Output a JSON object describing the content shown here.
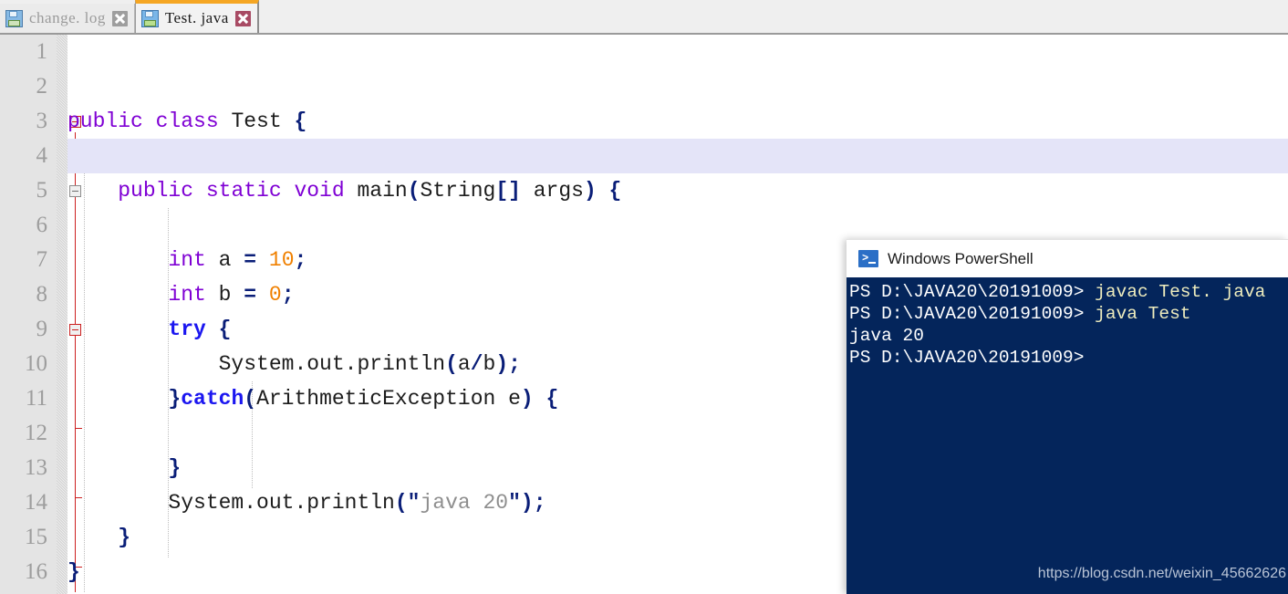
{
  "tabs": [
    {
      "label": "change. log",
      "icon": "floppy-disk-icon",
      "close_icon": "close-icon",
      "active": false
    },
    {
      "label": "Test. java",
      "icon": "floppy-disk-icon",
      "close_icon": "close-icon",
      "active": true
    }
  ],
  "editor": {
    "line_numbers": [
      "1",
      "2",
      "3",
      "4",
      "5",
      "6",
      "7",
      "8",
      "9",
      "10",
      "11",
      "12",
      "13",
      "14",
      "15",
      "16"
    ],
    "highlighted_line": 4,
    "lines": [
      {
        "n": 1,
        "text": ""
      },
      {
        "n": 2,
        "text": ""
      },
      {
        "n": 3,
        "text": "public class Test {"
      },
      {
        "n": 4,
        "text": ""
      },
      {
        "n": 5,
        "text": "    public static void main(String[] args) {"
      },
      {
        "n": 6,
        "text": ""
      },
      {
        "n": 7,
        "text": "        int a = 10;"
      },
      {
        "n": 8,
        "text": "        int b = 0;"
      },
      {
        "n": 9,
        "text": "        try {"
      },
      {
        "n": 10,
        "text": "            System.out.println(a/b);"
      },
      {
        "n": 11,
        "text": "        }catch(ArithmeticException e) {"
      },
      {
        "n": 12,
        "text": ""
      },
      {
        "n": 13,
        "text": "        }"
      },
      {
        "n": 14,
        "text": "        System.out.println(\"java 20\");"
      },
      {
        "n": 15,
        "text": "    }"
      },
      {
        "n": 16,
        "text": "}"
      }
    ],
    "colors": {
      "keyword": "#7f00d4",
      "keyword_control": "#1b16f0",
      "number": "#f08000",
      "bracket": "#0a1e78",
      "string": "#8e8e8e",
      "plain": "#1c1c1c",
      "gutter_bg": "#e4e4e4",
      "line_highlight": "#e4e4f8",
      "fold_marker": "#cc2020"
    }
  },
  "powershell": {
    "title": "Windows PowerShell",
    "icon": "powershell-icon",
    "background": "#04255b",
    "lines": [
      {
        "prompt": "PS D:\\JAVA20\\20191009> ",
        "command": "javac Test. java"
      },
      {
        "prompt": "PS D:\\JAVA20\\20191009> ",
        "command": "java Test"
      },
      {
        "prompt": "java 20",
        "command": ""
      },
      {
        "prompt": "PS D:\\JAVA20\\20191009>",
        "command": ""
      }
    ],
    "watermark": "https://blog.csdn.net/weixin_45662626"
  }
}
